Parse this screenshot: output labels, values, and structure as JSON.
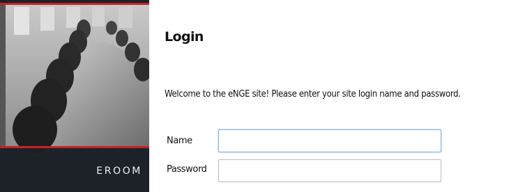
{
  "brand": {
    "name": "EROOM"
  },
  "login": {
    "title": "Login",
    "welcome": "Welcome to the eNGE site! Please enter your site login name and password.",
    "name_label": "Name",
    "name_value": "",
    "password_label": "Password",
    "password_value": ""
  },
  "colors": {
    "panel": "#1c2228",
    "accent_red": "#c8202a",
    "focus_border": "#84aee0"
  }
}
